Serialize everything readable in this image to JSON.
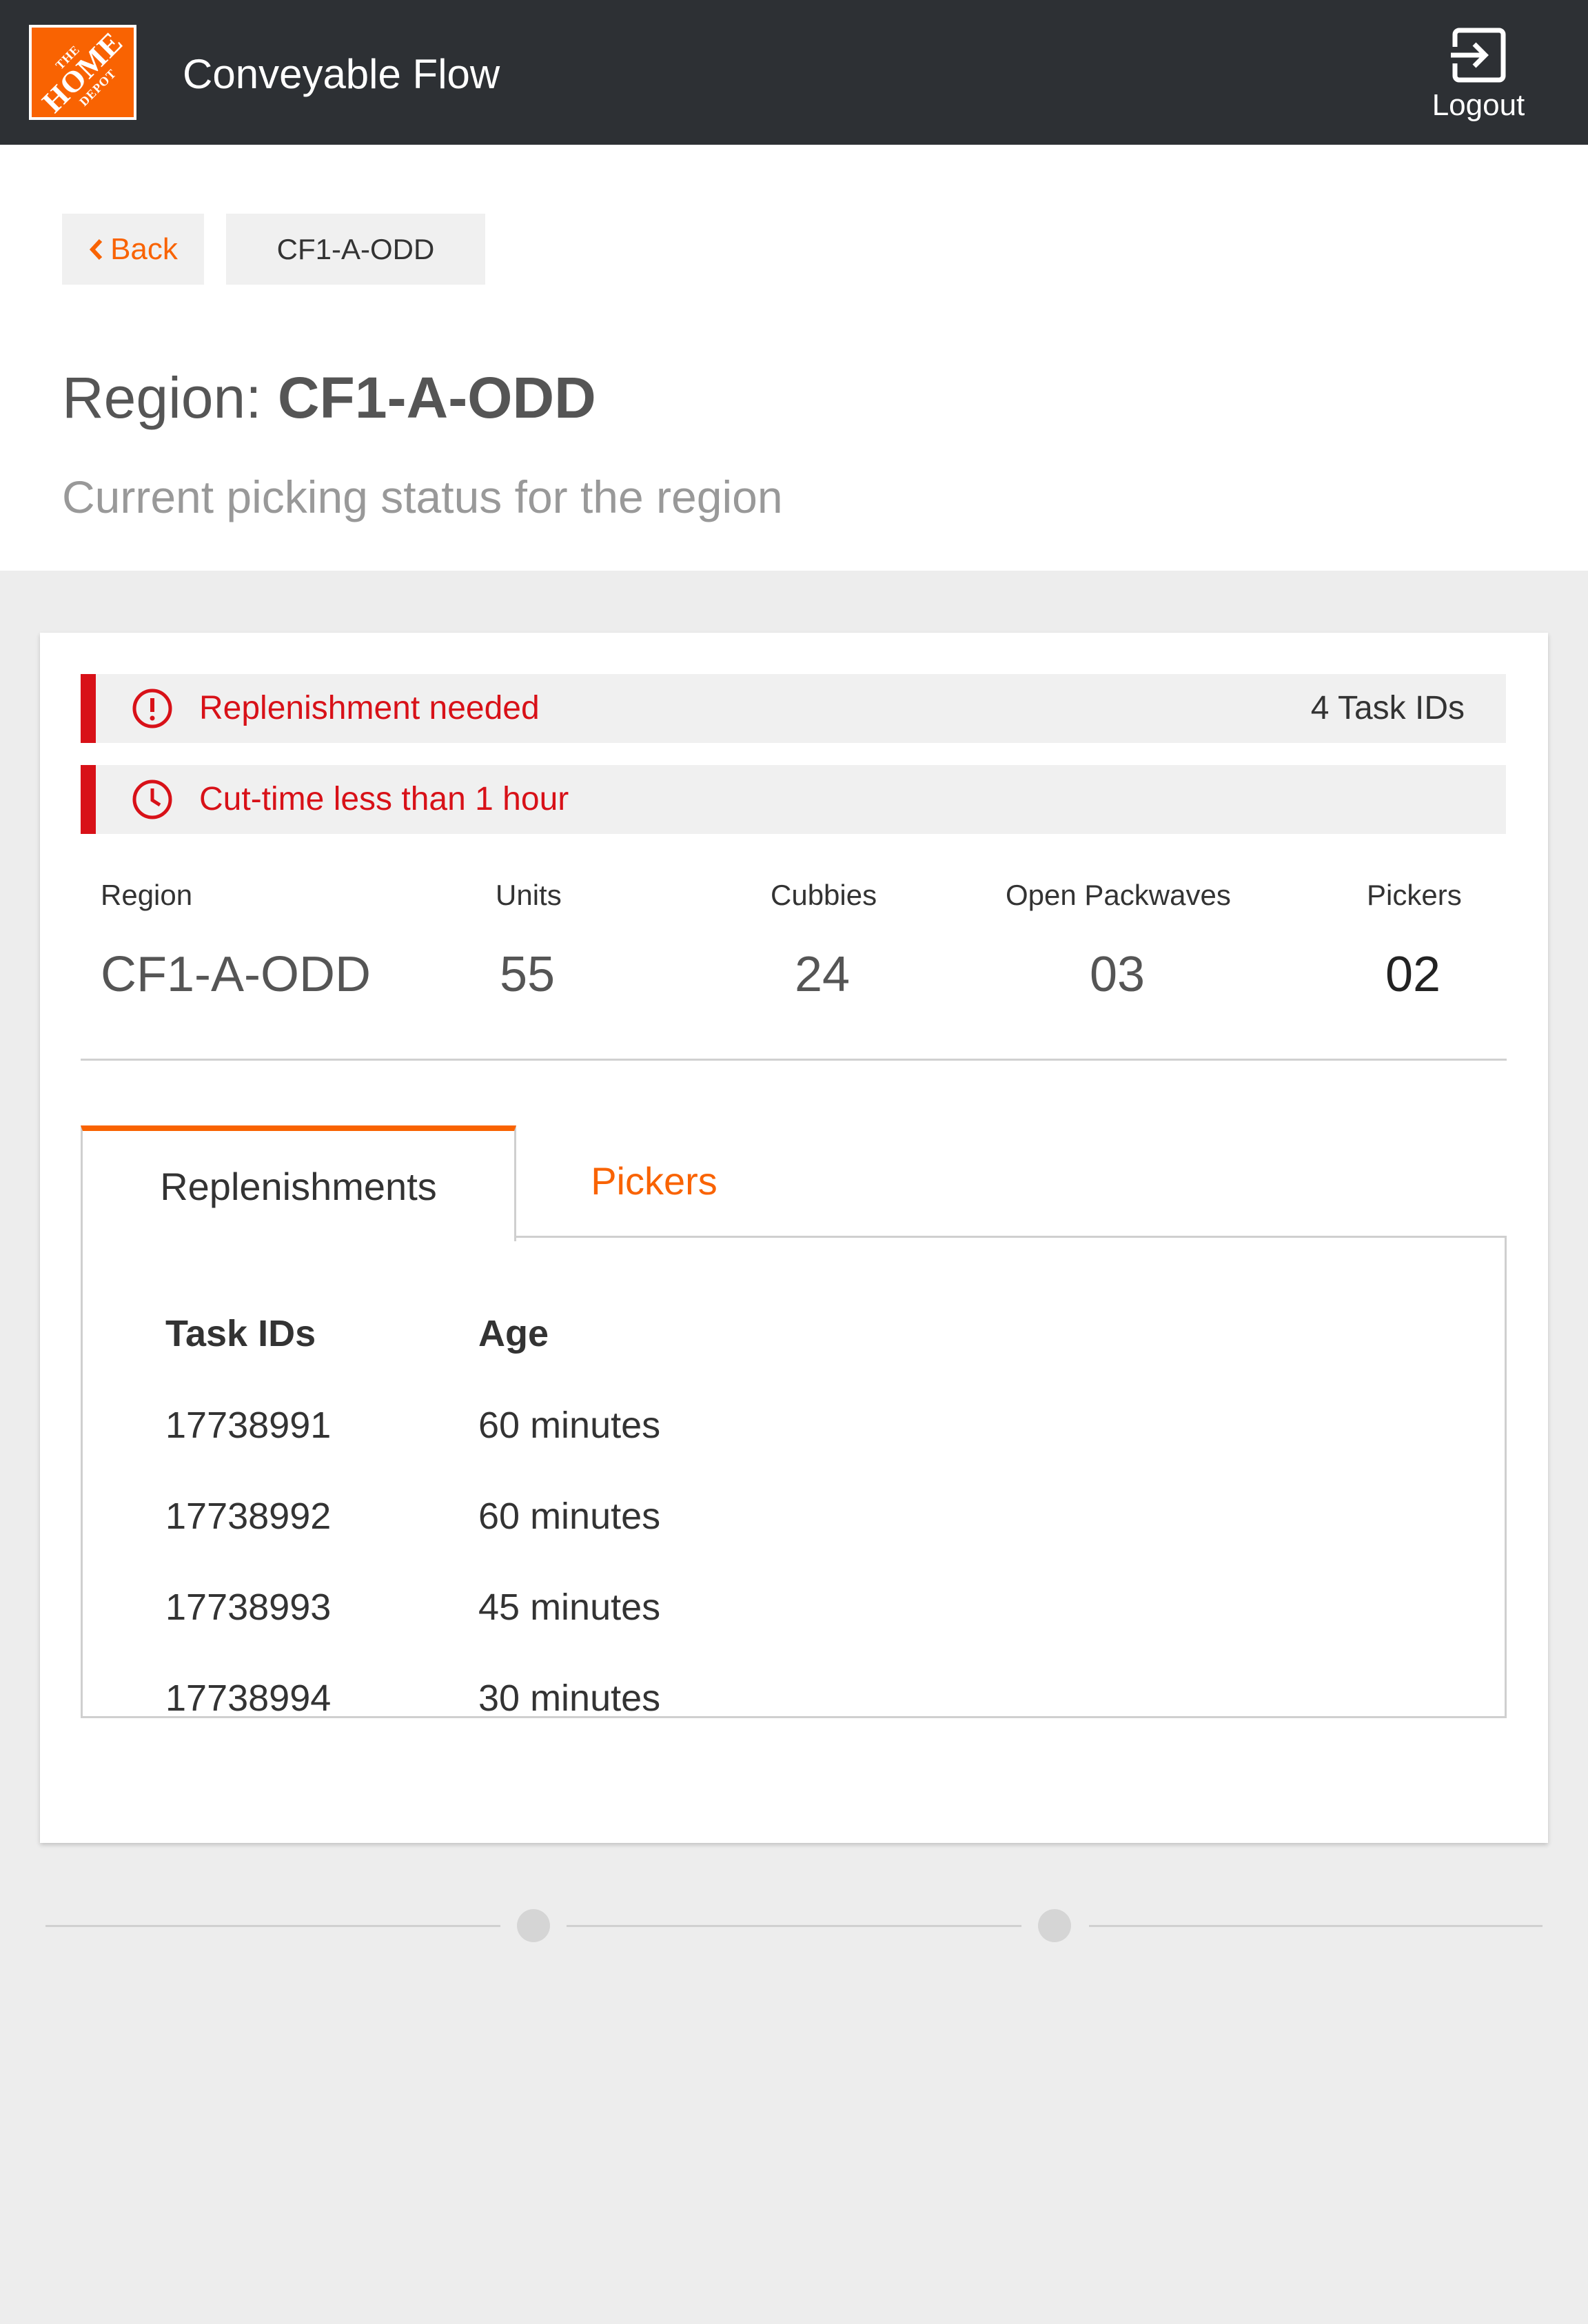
{
  "app": {
    "logo": {
      "line1": "THE",
      "line2": "HOME",
      "line3": "DEPOT"
    },
    "title": "Conveyable Flow",
    "logout_label": "Logout"
  },
  "nav": {
    "back_label": "Back",
    "breadcrumb": "CF1-A-ODD"
  },
  "page": {
    "title_prefix": "Region:",
    "title_value": "CF1-A-ODD",
    "subtitle": "Current picking status for the region"
  },
  "alerts": [
    {
      "text": "Replenishment needed",
      "count": "4 Task IDs",
      "icon": "alert-circle-icon"
    },
    {
      "text": "Cut-time less than 1 hour",
      "count": "",
      "icon": "clock-icon"
    }
  ],
  "stats": [
    {
      "label": "Region",
      "value": "CF1-A-ODD"
    },
    {
      "label": "Units",
      "value": "55"
    },
    {
      "label": "Cubbies",
      "value": "24"
    },
    {
      "label": "Open Packwaves",
      "value": "03"
    },
    {
      "label": "Pickers",
      "value": "02"
    }
  ],
  "tabs": [
    {
      "label": "Replenishments",
      "active": true
    },
    {
      "label": "Pickers",
      "active": false
    }
  ],
  "table": {
    "headers": [
      "Task IDs",
      "Age"
    ],
    "rows": [
      [
        "17738991",
        "60 minutes"
      ],
      [
        "17738992",
        "60 minutes"
      ],
      [
        "17738993",
        "45 minutes"
      ],
      [
        "17738994",
        "30 minutes"
      ]
    ]
  },
  "pager": {
    "dots": 2
  },
  "colors": {
    "brand_orange": "#f96302",
    "alert_red": "#d81118",
    "topbar": "#2d3034"
  }
}
